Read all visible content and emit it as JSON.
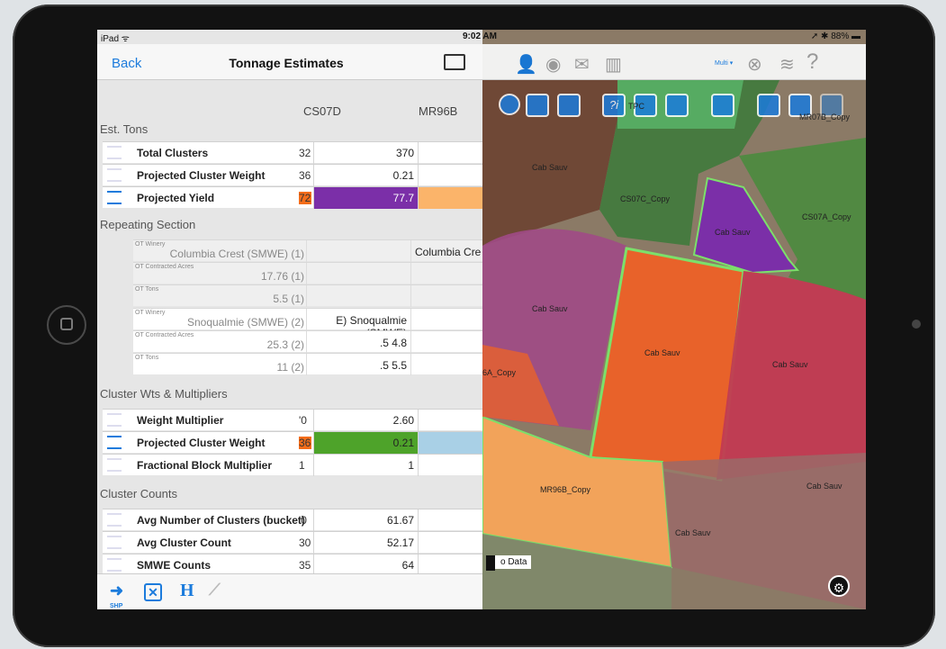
{
  "status": {
    "carrier": "iPad ᯤ",
    "time": "9:02 AM",
    "battery": "➚ ✱ 88% ▬"
  },
  "nav": {
    "back": "Back",
    "title": "Tonnage Estimates"
  },
  "columns": [
    "CS07D",
    "MR96B"
  ],
  "sections": {
    "est_tons": "Est. Tons",
    "repeating": "Repeating Section",
    "cluster_wts": "Cluster Wts & Multipliers",
    "cluster_counts": "Cluster Counts"
  },
  "est_rows": [
    {
      "label": "Total Clusters",
      "cut": "32",
      "value": "370"
    },
    {
      "label": "Projected Cluster Weight",
      "cut": "36",
      "value": "0.21"
    },
    {
      "label": "Projected Yield",
      "cut": "72",
      "value": "77.7"
    }
  ],
  "repeat_rows": [
    {
      "small": "OT Winery",
      "value": "Columbia Crest (SMWE) (1)",
      "c2": "",
      "c3": "Columbia Cre"
    },
    {
      "small": "OT Contracted Acres",
      "value": "17.76 (1)",
      "c2": "",
      "c3": ""
    },
    {
      "small": "OT Tons",
      "value": "5.5 (1)",
      "c2": "",
      "c3": ""
    },
    {
      "small": "OT Winery",
      "value": "Snoqualmie (SMWE) (2)",
      "c2": "E) Snoqualmie (SMWE)",
      "c3": ""
    },
    {
      "small": "OT Contracted Acres",
      "value": "25.3 (2)",
      "c2": ".5            4.8",
      "c3": ""
    },
    {
      "small": "OT Tons",
      "value": "11 (2)",
      "c2": ".5            5.5",
      "c3": ""
    }
  ],
  "wts_rows": [
    {
      "label": "Weight Multiplier",
      "cut": "'0",
      "value": "2.60"
    },
    {
      "label": "Projected Cluster Weight",
      "cut": "36",
      "value": "0.21"
    },
    {
      "label": "Fractional Block Multiplier",
      "cut": "1",
      "value": "1"
    }
  ],
  "count_rows": [
    {
      "label": "Avg Number of Clusters (bucket)",
      "cut": "'0",
      "value": "61.67"
    },
    {
      "label": "Avg Cluster Count",
      "cut": "30",
      "value": "52.17"
    },
    {
      "label": "SMWE Counts",
      "cut": "35",
      "value": "64"
    }
  ],
  "toolbar": {
    "shp": "SHP",
    "h": "H"
  },
  "map": {
    "multi": "Multi ▾",
    "help": "?",
    "labels": [
      "Cab Sauv",
      "CS07C_Copy",
      "Cab Sauv",
      "CS07A_Copy",
      "Cab Sauv",
      "Cab Sauv",
      "Cab Sauv",
      "6A_Copy",
      "MR96B_Copy",
      "Cab Sauv",
      "Cab Sauv",
      "TPC",
      "MR07B_Copy"
    ],
    "nodata": "o Data",
    "info": "?i"
  },
  "colors": {
    "accent": "#1b7bdc",
    "purple": "#7b2fa8",
    "orange": "#f46d1a",
    "green": "#4ea32a",
    "peach": "#fbb46a",
    "lightblue": "#a9d0e6"
  }
}
